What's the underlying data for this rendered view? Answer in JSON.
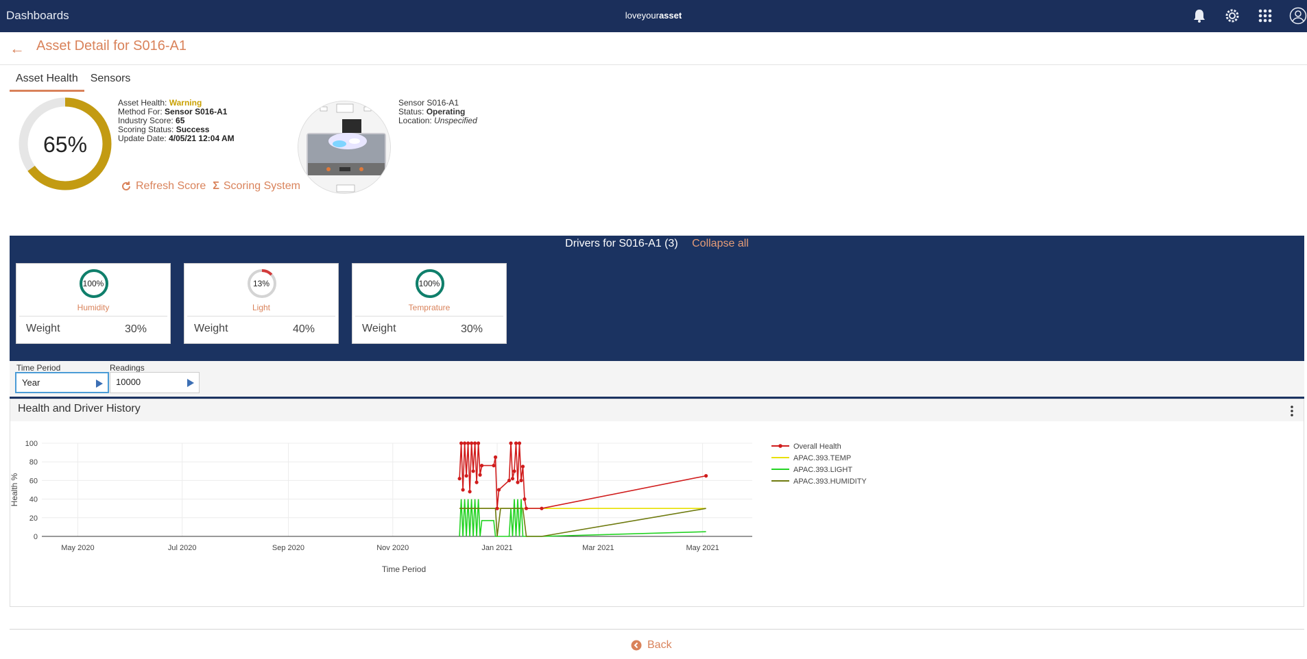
{
  "topbar": {
    "title": "Dashboards",
    "brand_light": "loveyour",
    "brand_bold": "asset",
    "icons": [
      "bell-icon",
      "gear-icon",
      "app-grid-icon",
      "user-avatar-icon"
    ]
  },
  "header": {
    "title": "Asset Detail for S016-A1"
  },
  "tabs": [
    {
      "label": "Asset Health",
      "active": true
    },
    {
      "label": "Sensors",
      "active": false
    }
  ],
  "health": {
    "score_label": "65%",
    "score": 65,
    "ring_color": "#c39b12",
    "asset_health_label": "Asset Health:",
    "asset_health_value": "Warning",
    "method_label": "Method For:",
    "method_value": "Sensor S016-A1",
    "industry_label": "Industry Score:",
    "industry_value": "65",
    "scoring_label": "Scoring Status:",
    "scoring_value": "Success",
    "update_label": "Update Date:",
    "update_value": "4/05/21 12:04 AM",
    "refresh_label": "Refresh Score",
    "scoring_system_label": "Scoring System"
  },
  "sensor": {
    "name": "Sensor S016-A1",
    "status_label": "Status:",
    "status_value": "Operating",
    "location_label": "Location:",
    "location_value": "Unspecified"
  },
  "drivers": {
    "title": "Drivers for S016-A1 (3)",
    "collapse_label": "Collapse all",
    "cards": [
      {
        "value_label": "100%",
        "value": 100,
        "name": "Humidity",
        "weight_label": "Weight",
        "weight": "30%",
        "color": "#0f7f6b"
      },
      {
        "value_label": "13%",
        "value": 13,
        "name": "Light",
        "weight_label": "Weight",
        "weight": "40%",
        "color": "#d23b3b"
      },
      {
        "value_label": "100%",
        "value": 100,
        "name": "Temprature",
        "weight_label": "Weight",
        "weight": "30%",
        "color": "#0f7f6b"
      }
    ]
  },
  "controls": {
    "time_period_label": "Time Period",
    "time_period_value": "Year",
    "readings_label": "Readings",
    "readings_value": "10000"
  },
  "chart_panel": {
    "title": "Health and Driver History",
    "menu_icon": "kebab-menu-icon"
  },
  "chart_data": {
    "type": "line",
    "xlabel": "Time Period",
    "ylabel": "Health %",
    "ylim": [
      0,
      100
    ],
    "yticks": [
      0,
      20,
      40,
      60,
      80,
      100
    ],
    "xlim": [
      "2020-04-10",
      "2021-05-30"
    ],
    "xticks": [
      {
        "date": "2020-05-01",
        "label": "May 2020"
      },
      {
        "date": "2020-07-01",
        "label": "Jul 2020"
      },
      {
        "date": "2020-09-01",
        "label": "Sep 2020"
      },
      {
        "date": "2020-11-01",
        "label": "Nov 2020"
      },
      {
        "date": "2021-01-01",
        "label": "Jan 2021"
      },
      {
        "date": "2021-03-01",
        "label": "Mar 2021"
      },
      {
        "date": "2021-05-01",
        "label": "May 2021"
      }
    ],
    "legend_position": "right",
    "series": [
      {
        "name": "Overall Health",
        "color": "#d01c1c",
        "markers": true,
        "x": [
          "2020-12-10",
          "2020-12-11",
          "2020-12-12",
          "2020-12-13",
          "2020-12-14",
          "2020-12-15",
          "2020-12-16",
          "2020-12-17",
          "2020-12-18",
          "2020-12-19",
          "2020-12-20",
          "2020-12-21",
          "2020-12-22",
          "2020-12-23",
          "2020-12-30",
          "2020-12-31",
          "2021-01-01",
          "2021-01-02",
          "2021-01-08",
          "2021-01-09",
          "2021-01-10",
          "2021-01-11",
          "2021-01-12",
          "2021-01-13",
          "2021-01-14",
          "2021-01-15",
          "2021-01-16",
          "2021-01-17",
          "2021-01-18",
          "2021-01-27",
          "2021-05-03"
        ],
        "y": [
          62,
          100,
          50,
          100,
          65,
          100,
          48,
          100,
          70,
          100,
          58,
          100,
          66,
          76,
          76,
          85,
          30,
          50,
          60,
          100,
          62,
          70,
          100,
          58,
          100,
          60,
          75,
          40,
          30,
          30,
          65
        ]
      },
      {
        "name": "APAC.393.TEMP",
        "color": "#e8e000",
        "markers": false,
        "x": [
          "2020-12-10",
          "2020-12-30",
          "2021-01-01",
          "2021-01-16",
          "2021-01-18",
          "2021-05-03"
        ],
        "y": [
          30,
          30,
          30,
          30,
          30,
          30
        ]
      },
      {
        "name": "APAC.393.LIGHT",
        "color": "#22d322",
        "markers": false,
        "x": [
          "2020-12-10",
          "2020-12-11",
          "2020-12-12",
          "2020-12-13",
          "2020-12-14",
          "2020-12-15",
          "2020-12-16",
          "2020-12-17",
          "2020-12-18",
          "2020-12-19",
          "2020-12-20",
          "2020-12-21",
          "2020-12-22",
          "2020-12-23",
          "2020-12-30",
          "2020-12-31",
          "2021-01-02",
          "2021-01-08",
          "2021-01-09",
          "2021-01-10",
          "2021-01-11",
          "2021-01-12",
          "2021-01-13",
          "2021-01-14",
          "2021-01-15",
          "2021-01-16",
          "2021-01-18",
          "2021-01-27",
          "2021-05-03"
        ],
        "y": [
          0,
          40,
          0,
          40,
          0,
          40,
          0,
          40,
          0,
          40,
          0,
          40,
          0,
          17,
          17,
          0,
          0,
          0,
          30,
          0,
          40,
          0,
          40,
          0,
          40,
          0,
          0,
          0,
          5
        ]
      },
      {
        "name": "APAC.393.HUMIDITY",
        "color": "#6e7a0e",
        "markers": false,
        "x": [
          "2020-12-10",
          "2020-12-30",
          "2020-12-31",
          "2021-01-01",
          "2021-01-03",
          "2021-01-08",
          "2021-01-16",
          "2021-01-18",
          "2021-01-27",
          "2021-05-03"
        ],
        "y": [
          30,
          30,
          30,
          0,
          30,
          30,
          30,
          0,
          0,
          30
        ]
      }
    ]
  },
  "footer": {
    "back_label": "Back"
  }
}
